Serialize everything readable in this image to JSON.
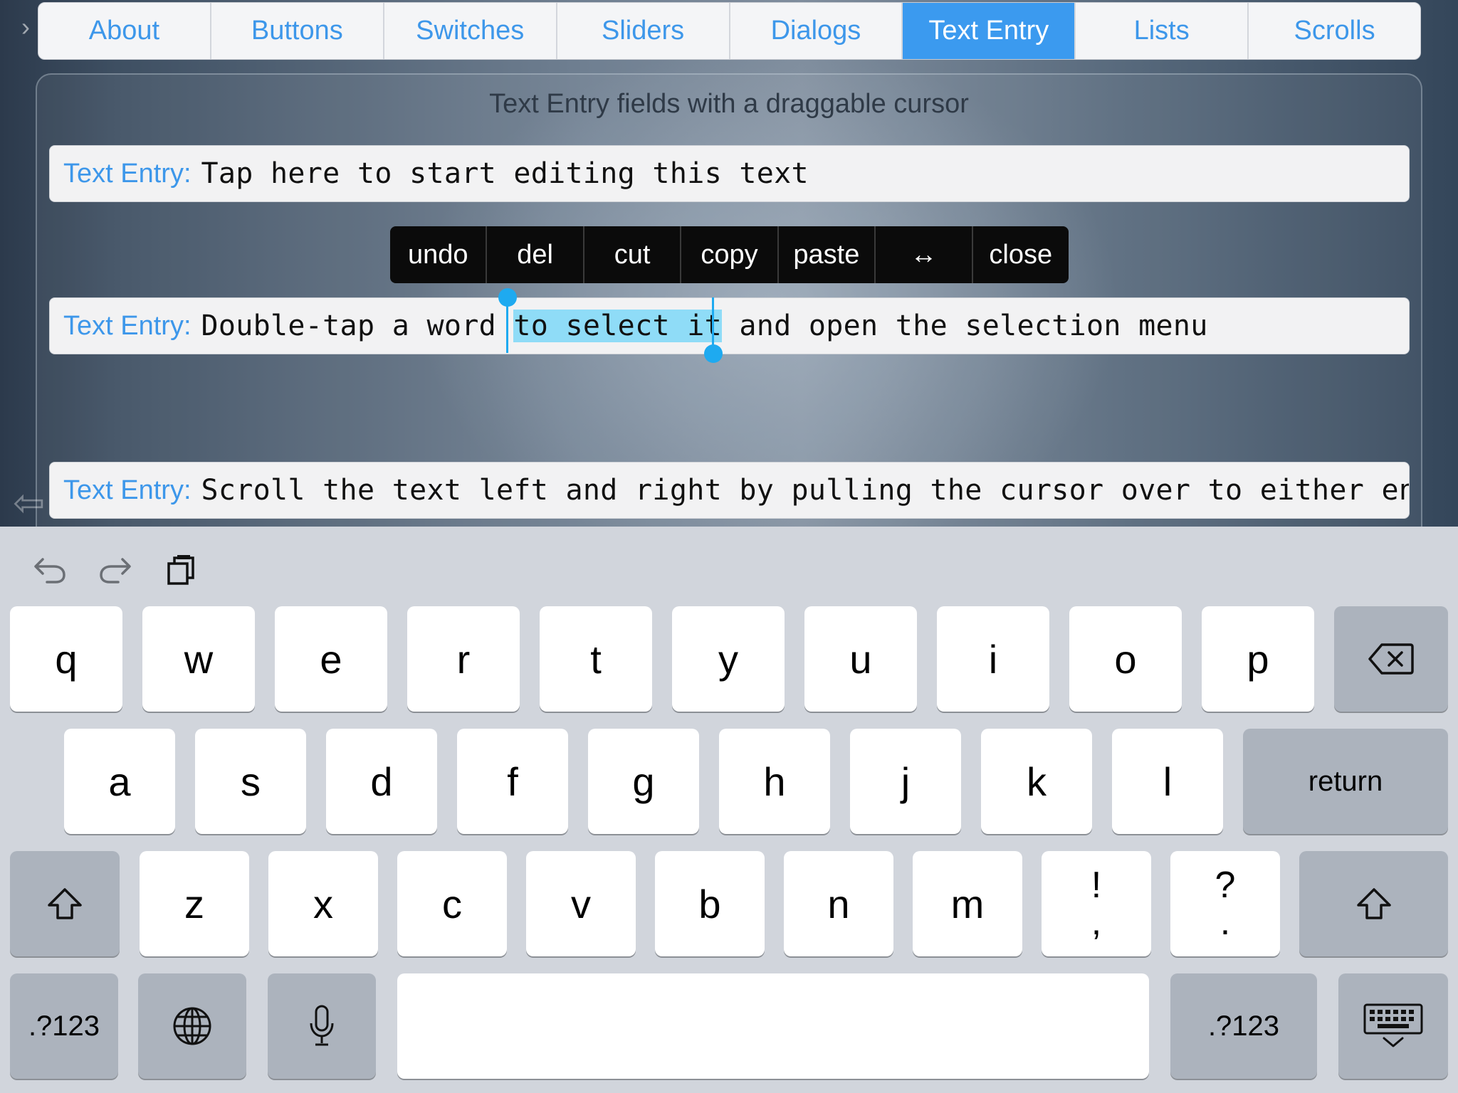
{
  "tabs": [
    {
      "label": "About",
      "active": false
    },
    {
      "label": "Buttons",
      "active": false
    },
    {
      "label": "Switches",
      "active": false
    },
    {
      "label": "Sliders",
      "active": false
    },
    {
      "label": "Dialogs",
      "active": false
    },
    {
      "label": "Text Entry",
      "active": true
    },
    {
      "label": "Lists",
      "active": false
    },
    {
      "label": "Scrolls",
      "active": false
    }
  ],
  "panel": {
    "title": "Text Entry fields with a draggable cursor"
  },
  "entries": [
    {
      "label": "Text Entry:",
      "text": "Tap here to start editing this text"
    },
    {
      "label": "Text Entry:",
      "text_before": "Double-tap a word ",
      "text_selected": "to select it",
      "text_after": " and open the selection menu"
    },
    {
      "label": "Text Entry:",
      "text": "Scroll the text left and right by pulling the cursor over to either en"
    }
  ],
  "context_menu": [
    "undo",
    "del",
    "cut",
    "copy",
    "paste",
    "↔",
    "close"
  ],
  "keyboard": {
    "toolbar": [
      "undo-icon",
      "redo-icon",
      "clipboard-icon"
    ],
    "row1": [
      "q",
      "w",
      "e",
      "r",
      "t",
      "y",
      "u",
      "i",
      "o",
      "p"
    ],
    "row2": [
      "a",
      "s",
      "d",
      "f",
      "g",
      "h",
      "j",
      "k",
      "l"
    ],
    "row3": [
      "z",
      "x",
      "c",
      "v",
      "b",
      "n",
      "m"
    ],
    "punct1": {
      "top": "!",
      "bottom": ","
    },
    "punct2": {
      "top": "?",
      "bottom": "."
    },
    "return_label": "return",
    "numbers_label": ".?123",
    "backspace_icon": "backspace-icon",
    "shift_icon": "shift-icon",
    "globe_icon": "globe-icon",
    "mic_icon": "microphone-icon",
    "dismiss_icon": "keyboard-dismiss-icon"
  },
  "colors": {
    "accent": "#3b9aef",
    "selection": "#8fdcf7",
    "handle": "#1eaaf0",
    "menu_bg": "#0b0b0b",
    "keyboard_bg": "#d1d5dc"
  }
}
